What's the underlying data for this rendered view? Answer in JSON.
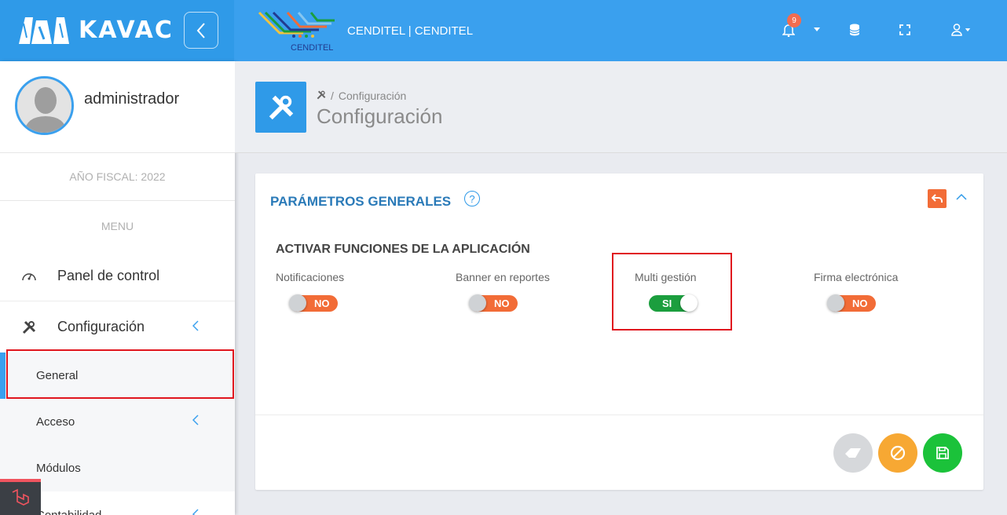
{
  "app": {
    "name": "KAVAC"
  },
  "topbar": {
    "org_name": "CENDITEL | CENDITEL",
    "logo_caption": "CENDITEL",
    "notifications_count": "9"
  },
  "user": {
    "name": "administrador"
  },
  "sidebar": {
    "fiscal_year": "AÑO FISCAL: 2022",
    "menu_title": "MENU",
    "items": [
      {
        "label": "Panel de control",
        "icon": "dashboard-icon"
      },
      {
        "label": "Configuración",
        "icon": "tools-icon"
      }
    ],
    "subitems": [
      {
        "label": "General",
        "active": true
      },
      {
        "label": "Acceso"
      },
      {
        "label": "Módulos"
      }
    ],
    "next_item_partial": "Contabilidad"
  },
  "page": {
    "breadcrumb": "Configuración",
    "title": "Configuración"
  },
  "card": {
    "title": "PARÁMETROS GENERALES",
    "help": "?",
    "section_title": "ACTIVAR FUNCIONES DE LA APLICACIÓN",
    "toggles": [
      {
        "label": "Notificaciones",
        "state": "NO",
        "on": false
      },
      {
        "label": "Banner en reportes",
        "state": "NO",
        "on": false
      },
      {
        "label": "Multi gestión",
        "state": "SI",
        "on": true
      },
      {
        "label": "Firma electrónica",
        "state": "NO",
        "on": false
      }
    ]
  },
  "colors": {
    "primary": "#3aa0ee",
    "off": "#f26c37",
    "on": "#1b9e3e",
    "warning": "#f7a833",
    "success": "#1bc23a",
    "highlight": "#e0161e"
  }
}
